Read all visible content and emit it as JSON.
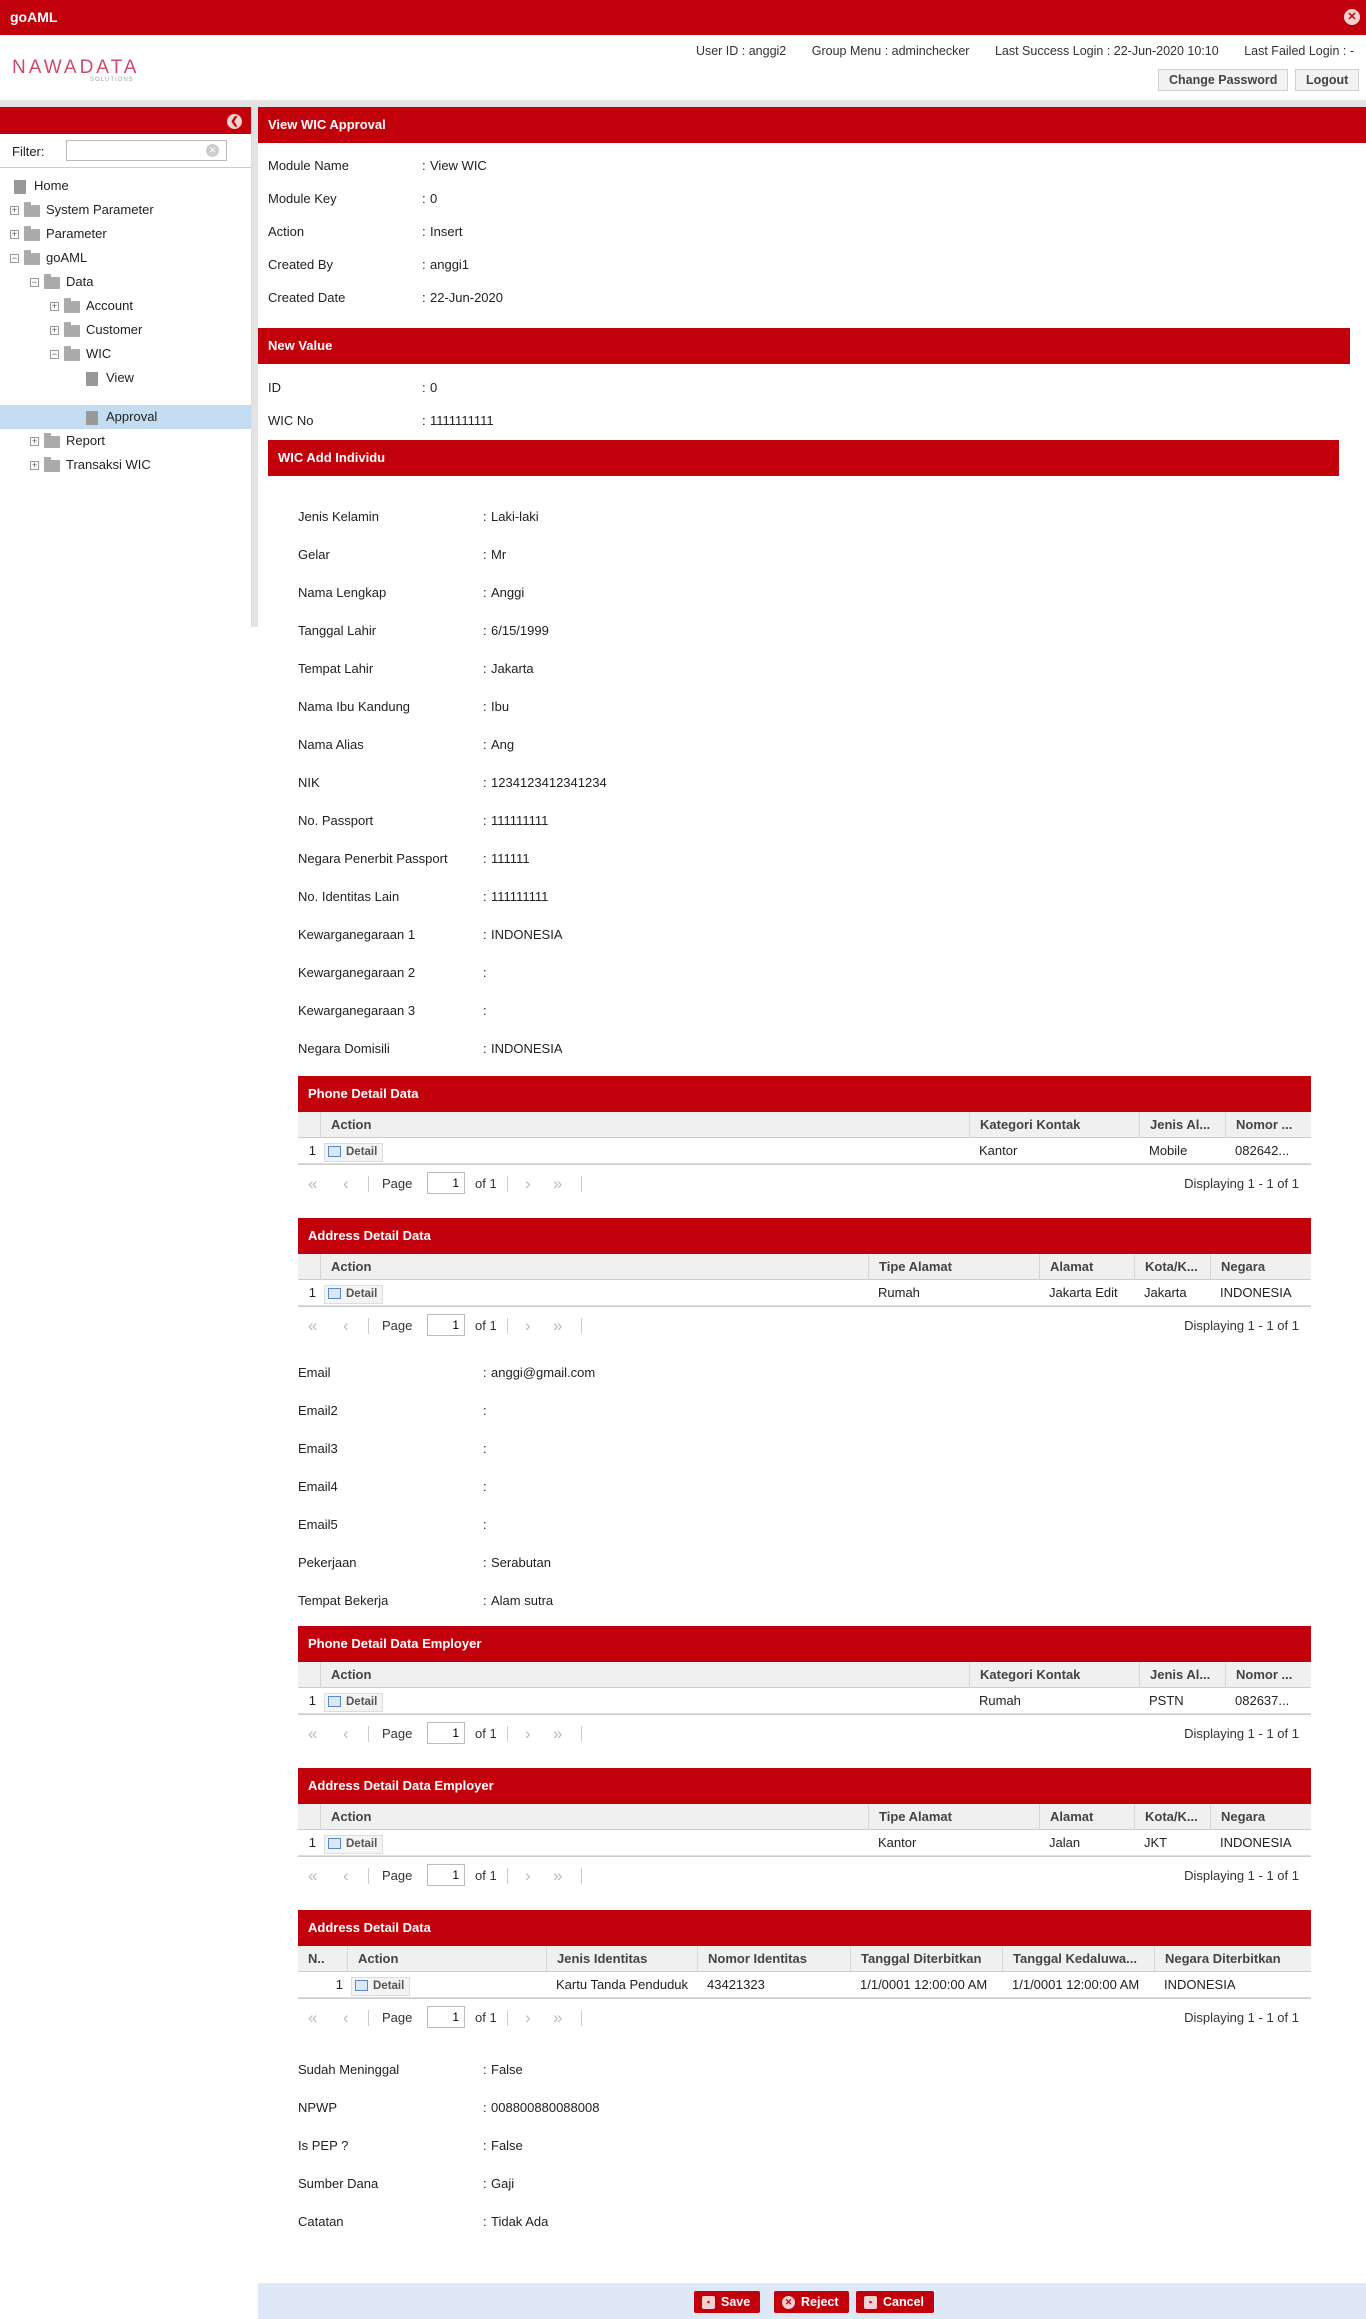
{
  "app": {
    "title": "goAML"
  },
  "brand": {
    "logo_main": "NAWADATA",
    "logo_sub": "SOLUTIONS"
  },
  "userinfo": {
    "user_id": "User ID : anggi2",
    "group_menu": "Group Menu : adminchecker",
    "last_success": "Last Success Login : 22-Jun-2020 10:10",
    "last_failed": "Last Failed Login : -"
  },
  "header_buttons": {
    "change_password": "Change Password",
    "logout": "Logout"
  },
  "sidebar": {
    "filter_label": "Filter:",
    "filter_value": "",
    "tree": [
      {
        "label": "Home"
      },
      {
        "label": "System Parameter"
      },
      {
        "label": "Parameter"
      },
      {
        "label": "goAML"
      },
      {
        "label": "Data"
      },
      {
        "label": "Account"
      },
      {
        "label": "Customer"
      },
      {
        "label": "WIC"
      },
      {
        "label": "View"
      },
      {
        "label": "Approval"
      },
      {
        "label": "Report"
      },
      {
        "label": "Transaksi WIC"
      }
    ]
  },
  "panel": {
    "title": "View WIC Approval",
    "fields": [
      {
        "label": "Module Name",
        "value": "View WIC"
      },
      {
        "label": "Module Key",
        "value": "0"
      },
      {
        "label": "Action",
        "value": "Insert"
      },
      {
        "label": "Created By",
        "value": "anggi1"
      },
      {
        "label": "Created Date",
        "value": "22-Jun-2020"
      }
    ]
  },
  "new_value": {
    "title": "New Value",
    "fields": [
      {
        "label": "ID",
        "value": "0"
      },
      {
        "label": "WIC No",
        "value": "1111111111"
      }
    ]
  },
  "individu": {
    "title": "WIC Add Individu",
    "fields": [
      {
        "label": "Jenis Kelamin",
        "value": "Laki-laki"
      },
      {
        "label": "Gelar",
        "value": "Mr"
      },
      {
        "label": "Nama Lengkap",
        "value": "Anggi"
      },
      {
        "label": "Tanggal Lahir",
        "value": "6/15/1999"
      },
      {
        "label": "Tempat Lahir",
        "value": "Jakarta"
      },
      {
        "label": "Nama Ibu Kandung",
        "value": "Ibu"
      },
      {
        "label": "Nama Alias",
        "value": "Ang"
      },
      {
        "label": "NIK",
        "value": "1234123412341234"
      },
      {
        "label": "No. Passport",
        "value": "111111111"
      },
      {
        "label": "Negara Penerbit Passport",
        "value": "111111"
      },
      {
        "label": "No. Identitas Lain",
        "value": "111111111"
      },
      {
        "label": "Kewarganegaraan 1",
        "value": "INDONESIA"
      },
      {
        "label": "Kewarganegaraan 2",
        "value": ""
      },
      {
        "label": "Kewarganegaraan 3",
        "value": ""
      },
      {
        "label": "Negara Domisili",
        "value": "INDONESIA"
      }
    ],
    "fields2": [
      {
        "label": "Email",
        "value": "anggi@gmail.com"
      },
      {
        "label": "Email2",
        "value": ""
      },
      {
        "label": "Email3",
        "value": ""
      },
      {
        "label": "Email4",
        "value": ""
      },
      {
        "label": "Email5",
        "value": ""
      },
      {
        "label": "Pekerjaan",
        "value": "Serabutan"
      },
      {
        "label": "Tempat Bekerja",
        "value": "Alam sutra"
      }
    ],
    "fields3": [
      {
        "label": "Sudah Meninggal",
        "value": "False"
      },
      {
        "label": "NPWP",
        "value": "008800880088008"
      },
      {
        "label": "Is PEP ?",
        "value": "False"
      },
      {
        "label": "Sumber Dana",
        "value": "Gaji"
      },
      {
        "label": "Catatan",
        "value": "Tidak Ada"
      }
    ]
  },
  "grids": [
    {
      "title": "Phone Detail Data",
      "columns": [
        "",
        "Action",
        "Kategori Kontak",
        "Jenis Al...",
        "Nomor ..."
      ],
      "row": [
        "1",
        "Detail",
        "Kantor",
        "Mobile",
        "082642..."
      ]
    },
    {
      "title": "Address Detail Data",
      "columns": [
        "",
        "Action",
        "Tipe Alamat",
        "Alamat",
        "Kota/K...",
        "Negara"
      ],
      "row": [
        "1",
        "Detail",
        "Rumah",
        "Jakarta Edit",
        "Jakarta",
        "INDONESIA"
      ]
    },
    {
      "title": "Phone Detail Data Employer",
      "columns": [
        "",
        "Action",
        "Kategori Kontak",
        "Jenis Al...",
        "Nomor ..."
      ],
      "row": [
        "1",
        "Detail",
        "Rumah",
        "PSTN",
        "082637..."
      ]
    },
    {
      "title": "Address Detail Data Employer",
      "columns": [
        "",
        "Action",
        "Tipe Alamat",
        "Alamat",
        "Kota/K...",
        "Negara"
      ],
      "row": [
        "1",
        "Detail",
        "Kantor",
        "Jalan",
        "JKT",
        "INDONESIA"
      ]
    },
    {
      "title": "Address Detail Data",
      "columns": [
        "N..",
        "Action",
        "Jenis Identitas",
        "Nomor Identitas",
        "Tanggal Diterbitkan",
        "Tanggal Kedaluwa...",
        "Negara Diterbitkan"
      ],
      "row": [
        "1",
        "Detail",
        "Kartu Tanda Penduduk",
        "43421323",
        "1/1/0001 12:00:00 AM",
        "1/1/0001 12:00:00 AM",
        "INDONESIA"
      ]
    }
  ],
  "pager": {
    "page_label": "Page",
    "page_value": "1",
    "of_label": "of 1",
    "displaying": "Displaying 1 - 1 of 1"
  },
  "footer": {
    "save": "Save",
    "reject": "Reject",
    "cancel": "Cancel"
  }
}
